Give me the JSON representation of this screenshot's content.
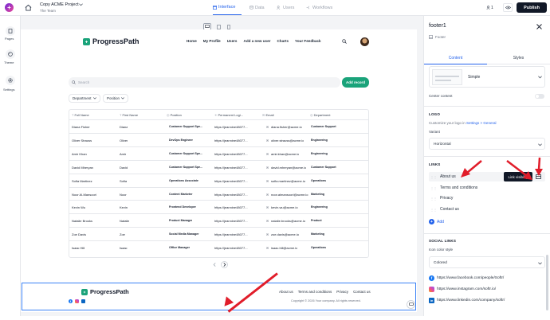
{
  "topbar": {
    "project_name": "Copy ACME Project",
    "team_name": "The Team",
    "tabs": [
      {
        "label": "Interface",
        "active": true
      },
      {
        "label": "Data",
        "active": false
      },
      {
        "label": "Users",
        "active": false
      },
      {
        "label": "Workflows",
        "active": false
      }
    ],
    "user_count": "1",
    "publish_label": "Publish"
  },
  "leftnav": {
    "items": [
      {
        "label": "Pages"
      },
      {
        "label": "Theme"
      },
      {
        "label": "Settings"
      }
    ]
  },
  "site": {
    "brand": "ProgressPath",
    "nav": [
      "Home",
      "My Profile",
      "Users",
      "Add a new user",
      "Charts",
      "Your Feedback"
    ],
    "search_placeholder": "Search",
    "add_record_label": "Add record",
    "filters": [
      "Department",
      "Position"
    ],
    "table": {
      "columns": [
        "Full Name",
        "First Name",
        "Position",
        "Permanent Logi...",
        "Email",
        "Department"
      ],
      "rows": [
        [
          "Diana Fisher",
          "Diana",
          "Customer Support Spe...",
          "https://jeannine48077...",
          "diana.fisher@acme.io",
          "Customer Support"
        ],
        [
          "Oliver Strauss",
          "Oliver",
          "DevOps Engineer",
          "https://jeannine48077...",
          "oliver.strauss@acme.io",
          "Engineering"
        ],
        [
          "Amir Khan",
          "Amir",
          "Customer Support Spe...",
          "https://jeannine48077...",
          "amir.khan@acme.io",
          "Engineering"
        ],
        [
          "David Mheryan",
          "David",
          "Customer Support Spe...",
          "https://jeannine48077...",
          "david.mheryan@acme.io",
          "Customer Support"
        ],
        [
          "Sofia Martinez",
          "Sofia",
          "Operations Associate",
          "https://jeannine48077...",
          "sofia.martinez@acme.io",
          "Operations"
        ],
        [
          "Noor Al-Mansoori",
          "Noor",
          "Content Marketer",
          "https://jeannine48077...",
          "noor.almansoori@acme.io",
          "Marketing"
        ],
        [
          "Kevin Wu",
          "Kevin",
          "Frontend Developer",
          "https://jeannine48077...",
          "kevin.wu@acme.io",
          "Engineering"
        ],
        [
          "Natalie Brooks",
          "Natalie",
          "Product Manager",
          "https://jeannine48077...",
          "natalie.brooks@acme.io",
          "Product"
        ],
        [
          "Zoe Davis",
          "Zoe",
          "Social Media Manager",
          "https://jeannine48077...",
          "zoe.davis@acme.io",
          "Marketing"
        ],
        [
          "Isaac Hill",
          "Isaac",
          "Office Manager",
          "https://jeannine48077...",
          "isaac.hill@acme.io",
          "Operations"
        ]
      ]
    },
    "footer": {
      "brand": "ProgressPath",
      "links": [
        "About us",
        "Terms and conditions",
        "Privacy",
        "Contact us"
      ],
      "copyright": "Copyright © 2026 Your company. All rights reserved."
    }
  },
  "panel": {
    "title": "footer1",
    "subtitle": "Footer",
    "tabs": [
      "Content",
      "Styles"
    ],
    "variant_preview_label": "Simple",
    "center_content_label": "Center content",
    "logo_section": "LOGO",
    "logo_hint": "Customize your logo in",
    "logo_hint_link": "Settings > General",
    "variant_label": "Variant",
    "variant_value": "Horizontal",
    "links_section": "LINKS",
    "links": [
      "About us",
      "Terms and conditions",
      "Privacy",
      "Contact us"
    ],
    "tooltip": "Link visibility",
    "add_label": "Add",
    "social_section": "SOCIAL LINKS",
    "icon_color_label": "Icon color style",
    "icon_color_value": "Colored",
    "social_links": [
      {
        "icon": "facebook-icon",
        "url": "https://www.facebook.com/people/Softr/"
      },
      {
        "icon": "instagram-icon",
        "url": "https://www.instagram.com/softr.io/"
      },
      {
        "icon": "linkedin-icon",
        "url": "https://www.linkedin.com/company/softr/"
      }
    ]
  },
  "colors": {
    "accent": "#2563eb",
    "brand_green": "#1aa37a",
    "arrow": "#e11d2a",
    "publish_bg": "#111827"
  }
}
